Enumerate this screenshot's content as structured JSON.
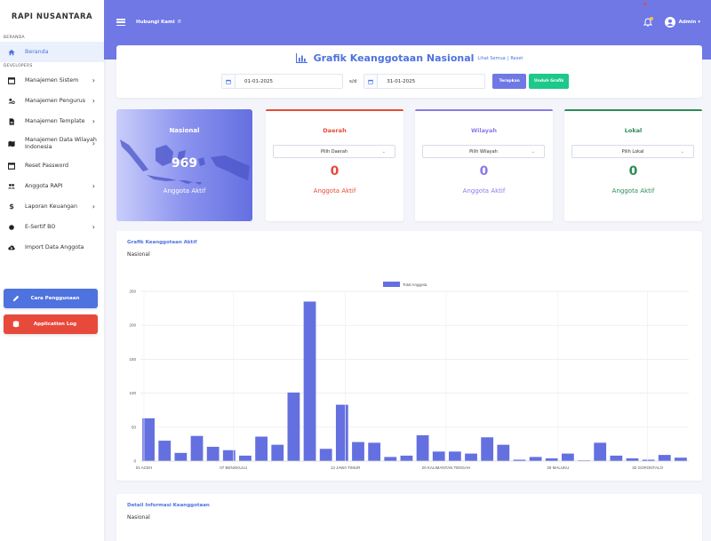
{
  "sidebar": {
    "brand": "RAPI NUSANTARA",
    "section_home": "BERANDA",
    "section_dev": "DEVELOPERS",
    "home_item": "Beranda",
    "items": [
      {
        "label": "Manajemen Sistem",
        "icon": "window-icon"
      },
      {
        "label": "Manajemen Pengurus",
        "icon": "users-gear-icon"
      },
      {
        "label": "Manajemen Template",
        "icon": "file-icon"
      },
      {
        "label": "Manajemen Data Wilayah Indonesia",
        "icon": "map-icon"
      },
      {
        "label": "Reset Password",
        "icon": "window-icon"
      },
      {
        "label": "Anggota RAPI",
        "icon": "users-icon"
      },
      {
        "label": "Laporan Keuangan",
        "icon": "dollar-icon"
      },
      {
        "label": "E-Sertif BO",
        "icon": "circle-icon"
      },
      {
        "label": "Import Data Anggota",
        "icon": "cloud-upload-icon"
      }
    ],
    "guide_button": "Cara Penggunaan",
    "log_button": "Application Log"
  },
  "topbar": {
    "contact": "Hubungi Kami",
    "user": "Admin"
  },
  "header": {
    "title": "Grafik Keanggotaan Nasional",
    "link_all": "Lihat Semua",
    "separator": "|",
    "link_reset": "Reset",
    "date_from": "01-01-2025",
    "date_sep": "s/d",
    "date_to": "31-01-2025",
    "apply": "Terapkan",
    "download": "Unduh Grafik"
  },
  "national": {
    "label": "Nasional",
    "count": "969",
    "sub": "Anggota Aktif"
  },
  "cards": [
    {
      "label": "Daerah",
      "select": "Pilih Daerah",
      "count": "0",
      "sub": "Anggota Aktif",
      "color": "#e74a3b"
    },
    {
      "label": "Wilayah",
      "select": "Pilih Wilayah",
      "count": "0",
      "sub": "Anggota Aktif",
      "color": "#8c7ae6"
    },
    {
      "label": "Lokal",
      "select": "Pilih Lokal",
      "count": "0",
      "sub": "Anggota Aktif",
      "color": "#2e8b57"
    }
  ],
  "chart_card": {
    "title": "Grafik Keanggotaan Aktif",
    "subtitle": "Nasional"
  },
  "detail_card": {
    "title": "Detail Informasi Keanggotaan",
    "subtitle": "Nasional"
  },
  "chart_data": {
    "type": "bar",
    "series": [
      {
        "name": "Total Anggota",
        "color": "#6470e0",
        "values": [
          63,
          30,
          12,
          37,
          21,
          16,
          8,
          36,
          24,
          101,
          235,
          18,
          83,
          28,
          27,
          6,
          8,
          38,
          14,
          14,
          11,
          35,
          24,
          2,
          6,
          4,
          11,
          1,
          27,
          8,
          4,
          2,
          9,
          5
        ]
      }
    ],
    "tick_labels": [
      "01 ACEH",
      "07 BENGKULU",
      "13 JAWA TIMUR",
      "20 KALIMANTAN TENGAH",
      "28 MALUKU",
      "32 GORONTALO"
    ],
    "tick_indices": [
      0,
      8,
      18,
      27,
      37,
      45
    ],
    "yticks": [
      0,
      50,
      100,
      150,
      200,
      250
    ],
    "ylim": [
      0,
      250
    ],
    "grid": true,
    "legend": "top-center"
  }
}
